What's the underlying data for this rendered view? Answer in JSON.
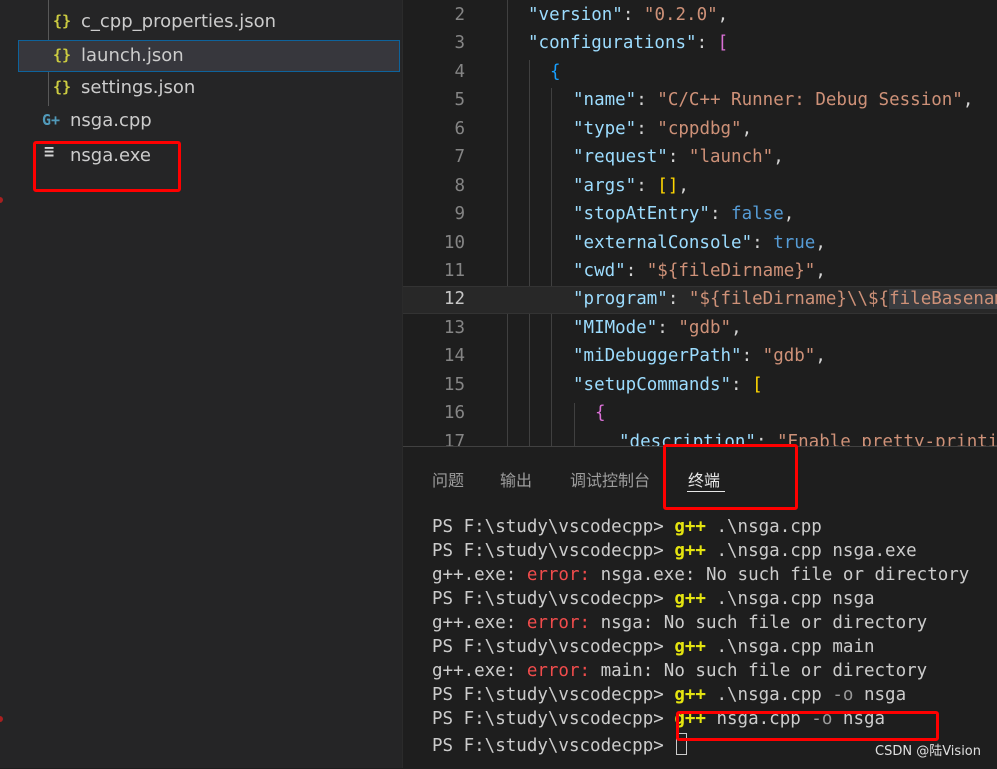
{
  "explorer": {
    "files": [
      {
        "icon": "{}",
        "name": "c_cpp_properties.json"
      },
      {
        "icon": "{}",
        "name": "launch.json"
      },
      {
        "icon": "{}",
        "name": "settings.json"
      },
      {
        "icon": "G+",
        "name": "nsga.cpp"
      },
      {
        "icon": "≡",
        "name": "nsga.exe"
      }
    ]
  },
  "editor": {
    "line_numbers": [
      "2",
      "3",
      "4",
      "5",
      "6",
      "7",
      "8",
      "9",
      "10",
      "11",
      "12",
      "13",
      "14",
      "15",
      "16",
      "17"
    ],
    "tokens": {
      "l2": [
        "\"version\"",
        ": ",
        "\"0.2.0\"",
        ","
      ],
      "l3": [
        "\"configurations\"",
        ": ",
        "["
      ],
      "l4": [
        "{"
      ],
      "l5": [
        "\"name\"",
        ": ",
        "\"C/C++ Runner: Debug Session\"",
        ","
      ],
      "l6": [
        "\"type\"",
        ": ",
        "\"cppdbg\"",
        ","
      ],
      "l7": [
        "\"request\"",
        ": ",
        "\"launch\"",
        ","
      ],
      "l8": [
        "\"args\"",
        ": ",
        "[]",
        ","
      ],
      "l9": [
        "\"stopAtEntry\"",
        ": ",
        "false",
        ","
      ],
      "l10": [
        "\"externalConsole\"",
        ": ",
        "true",
        ","
      ],
      "l11": [
        "\"cwd\"",
        ": ",
        "\"${fileDirname}\"",
        ","
      ],
      "l12": [
        "\"program\"",
        ": ",
        "\"${fileDirname}\\\\${",
        "fileBasenameNoExtension}.exe\""
      ],
      "l13": [
        "\"MIMode\"",
        ": ",
        "\"gdb\"",
        ","
      ],
      "l14": [
        "\"miDebuggerPath\"",
        ": ",
        "\"gdb\"",
        ","
      ],
      "l15": [
        "\"setupCommands\"",
        ": ",
        "["
      ],
      "l16": [
        "{"
      ],
      "l17": [
        "\"description\"",
        ": ",
        "\"Enable pretty-printing for gdb\""
      ]
    }
  },
  "panel": {
    "tabs": [
      "问题",
      "输出",
      "调试控制台",
      "终端"
    ],
    "prompt": "PS F:\\study\\vscodecpp> ",
    "lines": [
      {
        "cmd": "g++",
        "rest": " .\\nsga.cpp"
      },
      {
        "cmd": "g++",
        "rest": " .\\nsga.cpp nsga.exe"
      },
      {
        "prefix": "g++.exe: ",
        "error": "error:",
        "rest": " nsga.exe: No such file or directory"
      },
      {
        "cmd": "g++",
        "rest": " .\\nsga.cpp nsga"
      },
      {
        "prefix": "g++.exe: ",
        "error": "error:",
        "rest": " nsga: No such file or directory"
      },
      {
        "cmd": "g++",
        "rest": " .\\nsga.cpp main"
      },
      {
        "prefix": "g++.exe: ",
        "error": "error:",
        "rest": " main: No such file or directory"
      },
      {
        "cmd": "g++",
        "rest": " .\\nsga.cpp ",
        "opt": "-o",
        "tail": " nsga"
      },
      {
        "cmd": "g++",
        "rest": " nsga.cpp ",
        "opt": "-o",
        "tail": " nsga"
      }
    ]
  },
  "watermark": "CSDN @陆Vision"
}
